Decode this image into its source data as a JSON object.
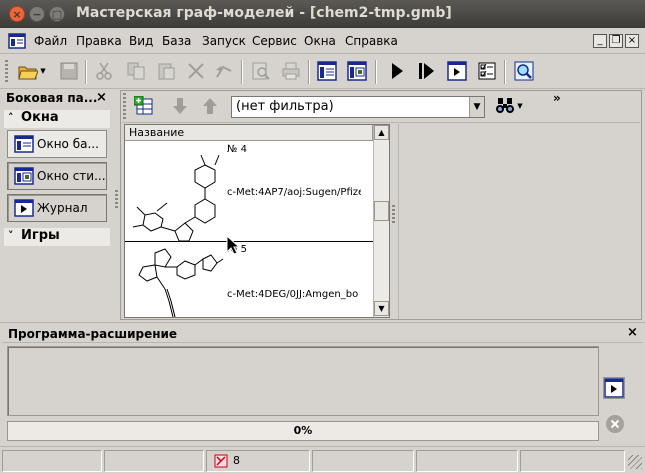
{
  "window": {
    "title": "Мастерская граф-моделей - [chem2-tmp.gmb]"
  },
  "menu": {
    "items": [
      "Файл",
      "Правка",
      "Вид",
      "База",
      "Запуск",
      "Сервис",
      "Окна",
      "Справка"
    ]
  },
  "side_panel": {
    "title": "Боковая па...",
    "close": "×",
    "group_windows": {
      "label": "Окна",
      "toggle": "˄"
    },
    "buttons": [
      "Окно ба...",
      "Окно сти...",
      "Журнал"
    ],
    "group_games": {
      "label": "Игры",
      "toggle": "˅"
    }
  },
  "filter": {
    "selected": "(нет фильтра)"
  },
  "list": {
    "column": "Название",
    "items": [
      {
        "index": "№ 4",
        "label": "c-Met:4AP7/aoj:Sugen/Pfize"
      },
      {
        "index": "№ 5",
        "label": "c-Met:4DEG/0JJ:Amgen_bo"
      }
    ]
  },
  "overflow": "»",
  "extension": {
    "title": "Программа-расширение",
    "close": "×",
    "progress": "0%"
  },
  "status": {
    "count": "8"
  }
}
